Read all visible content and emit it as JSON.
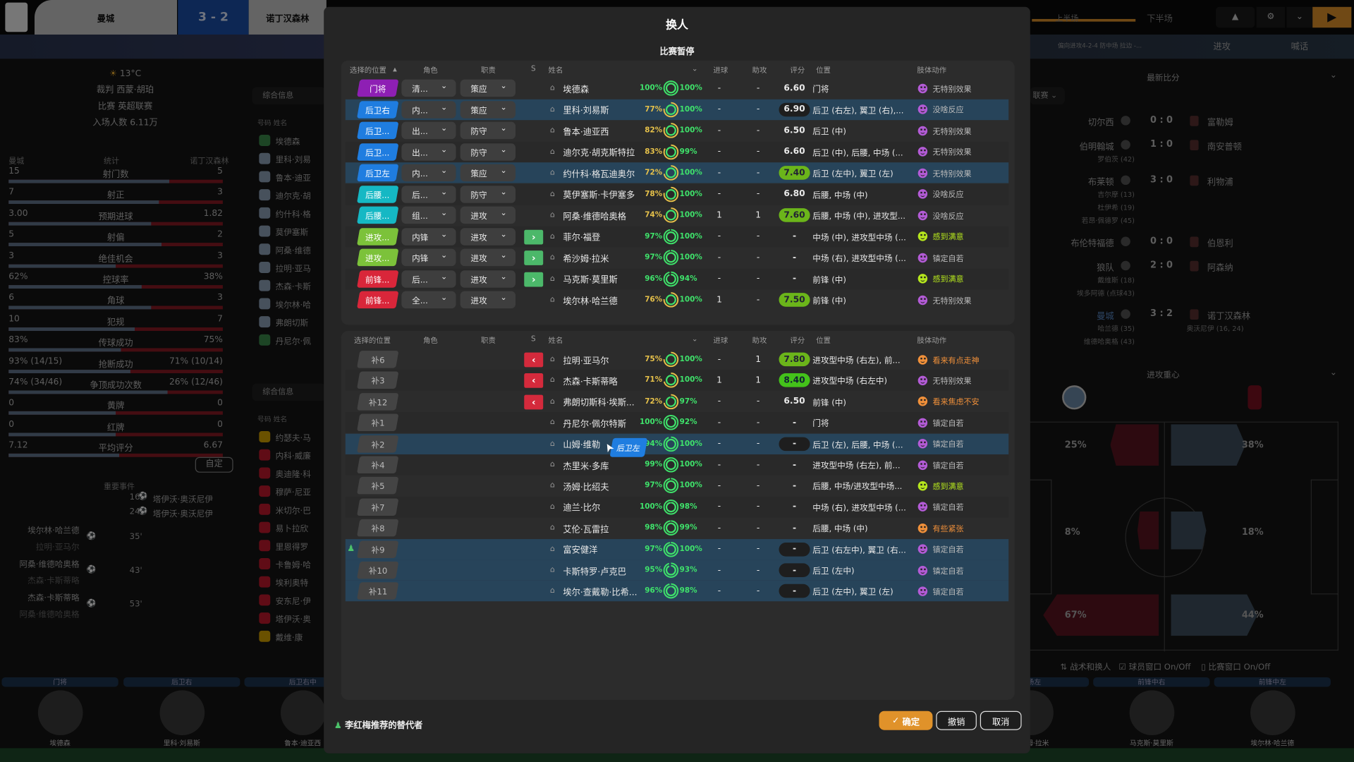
{
  "topbar": {
    "home": "曼城",
    "score": "3 - 2",
    "away": "诺丁汉森林",
    "league_logo": "Premier League",
    "half_first": "上半场",
    "half_second": "下半场",
    "tactic": "偏向进攻4-2-4 防中场 拉边 -...",
    "attack_label": "进攻",
    "shout_label": "喊话",
    "icons": [
      "car-icon",
      "gear-icon",
      "chevron-down-icon",
      "play-icon"
    ],
    "accent": "#e0922a"
  },
  "match_info": {
    "temp": "13°C",
    "referee": "裁判 西蒙·胡珀",
    "competition": "比赛 英超联赛",
    "attendance": "入场人数 6.11万"
  },
  "stats": {
    "home": "曼城",
    "title": "统计",
    "away": "诺丁汉森林",
    "custom_label": "自定",
    "rows": [
      {
        "label": "射门数",
        "home": "15",
        "away": "5",
        "share": 0.75
      },
      {
        "label": "射正",
        "home": "7",
        "away": "3",
        "share": 0.7
      },
      {
        "label": "预期进球",
        "home": "3.00",
        "away": "1.82",
        "share": 0.667
      },
      {
        "label": "射偏",
        "home": "5",
        "away": "2",
        "share": 0.715
      },
      {
        "label": "绝佳机会",
        "home": "3",
        "away": "3",
        "share": 0.5
      },
      {
        "label": "控球率",
        "home": "62%",
        "away": "38%",
        "share": 0.62
      },
      {
        "label": "角球",
        "home": "6",
        "away": "3",
        "share": 0.667
      },
      {
        "label": "犯规",
        "home": "10",
        "away": "7",
        "share": 0.59
      },
      {
        "label": "传球成功",
        "home": "83%",
        "away": "75%",
        "share": 0.525
      },
      {
        "label": "抢断成功",
        "home": "93% (14/15)",
        "away": "71% (10/14)",
        "share": 0.57
      },
      {
        "label": "争顶成功次数",
        "home": "74% (34/46)",
        "away": "26% (12/46)",
        "share": 0.74
      },
      {
        "label": "黄牌",
        "home": "0",
        "away": "0",
        "share": 0.5
      },
      {
        "label": "红牌",
        "home": "0",
        "away": "0",
        "share": 0.5
      },
      {
        "label": "平均评分",
        "home": "7.12",
        "away": "6.67",
        "share": 0.515
      }
    ]
  },
  "events": {
    "title": "重要事件",
    "items": [
      {
        "minute": "16'",
        "side": "away",
        "player": "塔伊沃·奥沃尼伊"
      },
      {
        "minute": "24'",
        "side": "away",
        "player": "塔伊沃·奥沃尼伊"
      },
      {
        "minute": "35'",
        "side": "home",
        "player": "埃尔林·哈兰德",
        "assist": "拉明·亚马尔"
      },
      {
        "minute": "43'",
        "side": "home",
        "player": "阿桑·维德哈奥格",
        "assist": "杰森·卡斯蒂略"
      },
      {
        "minute": "53'",
        "side": "home",
        "player": "杰森·卡斯蒂略",
        "assist": "阿桑·维德哈奥格"
      }
    ]
  },
  "lineups": {
    "filter_label": "综合信息",
    "col_number": "号码",
    "col_name": "姓名",
    "home": [
      "埃德森",
      "里科·刘易",
      "鲁本·迪亚",
      "迪尔克·胡",
      "约什科·格",
      "莫伊塞斯",
      "阿桑·维德",
      "拉明·亚马",
      "杰森·卡斯",
      "埃尔林·哈",
      "弗朗切斯",
      "丹尼尔·佩"
    ],
    "away": [
      "约瑟夫·马",
      "内科·威廉",
      "奥迪隆·科",
      "穆萨·尼亚",
      "米切尔·巴",
      "易卜拉欣",
      "里恩得罗",
      "卡鲁姆·哈",
      "埃利奥特",
      "安东尼·伊",
      "塔伊沃·奥",
      "戴维·康"
    ]
  },
  "modal": {
    "title": "换人",
    "subtitle": "比赛暂停",
    "headers": {
      "position": "选择的位置",
      "role": "角色",
      "duty": "职责",
      "s": "S",
      "name": "姓名",
      "goals": "进球",
      "assists": "助攻",
      "rating": "评分",
      "positions": "位置",
      "body_language": "肢体动作"
    },
    "starters": [
      {
        "pos": "门将",
        "posColor": "#8e1fb4",
        "role": "清...",
        "duty": "策应",
        "arrow": "",
        "name": "埃德森",
        "cond": "100%",
        "sharp": "100%",
        "goals": "-",
        "assists": "-",
        "rating": "6.60",
        "ratingStyle": "plain",
        "positions": "门将",
        "mood": "无特别效果",
        "moodColor": "#b35bd6",
        "hl": false
      },
      {
        "pos": "后卫右",
        "posColor": "#1f7de0",
        "role": "内...",
        "duty": "策应",
        "arrow": "",
        "name": "里科·刘易斯",
        "cond": "77%",
        "sharp": "100%",
        "goals": "-",
        "assists": "-",
        "rating": "6.90",
        "ratingStyle": "dark",
        "positions": "后卫 (右左), 翼卫 (右),...",
        "mood": "没啥反应",
        "moodColor": "#b35bd6",
        "hl": true
      },
      {
        "pos": "后卫...",
        "posColor": "#1f7de0",
        "role": "出...",
        "duty": "防守",
        "arrow": "",
        "name": "鲁本·迪亚西",
        "cond": "82%",
        "sharp": "100%",
        "goals": "-",
        "assists": "-",
        "rating": "6.50",
        "ratingStyle": "plain",
        "positions": "后卫 (中)",
        "mood": "无特别效果",
        "moodColor": "#b35bd6",
        "hl": false
      },
      {
        "pos": "后卫...",
        "posColor": "#1f7de0",
        "role": "出...",
        "duty": "防守",
        "arrow": "",
        "name": "迪尔克·胡克斯特拉",
        "cond": "83%",
        "sharp": "99%",
        "goals": "-",
        "assists": "-",
        "rating": "6.60",
        "ratingStyle": "plain",
        "positions": "后卫 (中), 后腰, 中场 (...",
        "mood": "无特别效果",
        "moodColor": "#b35bd6",
        "hl": false
      },
      {
        "pos": "后卫左",
        "posColor": "#1f7de0",
        "role": "内...",
        "duty": "策应",
        "arrow": "",
        "name": "约什科·格瓦迪奥尔",
        "cond": "72%",
        "sharp": "100%",
        "goals": "-",
        "assists": "-",
        "rating": "7.40",
        "ratingStyle": "green",
        "positions": "后卫 (左中), 翼卫 (左)",
        "mood": "无特别效果",
        "moodColor": "#b35bd6",
        "hl": true
      },
      {
        "pos": "后腰...",
        "posColor": "#15b8c4",
        "role": "后...",
        "duty": "防守",
        "arrow": "",
        "name": "莫伊塞斯·卡伊塞多",
        "cond": "78%",
        "sharp": "100%",
        "goals": "-",
        "assists": "-",
        "rating": "6.80",
        "ratingStyle": "plain",
        "positions": "后腰, 中场 (中)",
        "mood": "没啥反应",
        "moodColor": "#b35bd6",
        "hl": false
      },
      {
        "pos": "后腰...",
        "posColor": "#15b8c4",
        "role": "组...",
        "duty": "进攻",
        "arrow": "",
        "name": "阿桑·维德哈奥格",
        "cond": "74%",
        "sharp": "100%",
        "goals": "1",
        "assists": "1",
        "rating": "7.60",
        "ratingStyle": "green",
        "positions": "后腰, 中场 (中), 进攻型...",
        "mood": "没啥反应",
        "moodColor": "#b35bd6",
        "hl": false
      },
      {
        "pos": "进攻...",
        "posColor": "#7cc23a",
        "role": "内锋",
        "duty": "进攻",
        "arrow": "out",
        "name": "菲尔·福登",
        "cond": "97%",
        "sharp": "100%",
        "goals": "-",
        "assists": "-",
        "rating": "-",
        "ratingStyle": "plain",
        "positions": "中场 (中), 进攻型中场 (...",
        "mood": "感到满意",
        "moodColor": "#b5e61d",
        "hl": false
      },
      {
        "pos": "进攻...",
        "posColor": "#7cc23a",
        "role": "内锋",
        "duty": "进攻",
        "arrow": "out",
        "name": "希沙姆·拉米",
        "cond": "97%",
        "sharp": "100%",
        "goals": "-",
        "assists": "-",
        "rating": "-",
        "ratingStyle": "plain",
        "positions": "中场 (右), 进攻型中场 (...",
        "mood": "镇定自若",
        "moodColor": "#b35bd6",
        "hl": false
      },
      {
        "pos": "前锋...",
        "posColor": "#d9263a",
        "role": "后...",
        "duty": "进攻",
        "arrow": "out",
        "name": "马克斯·莫里斯",
        "cond": "96%",
        "sharp": "94%",
        "goals": "-",
        "assists": "-",
        "rating": "-",
        "ratingStyle": "plain",
        "positions": "前锋 (中)",
        "mood": "感到满意",
        "moodColor": "#b5e61d",
        "hl": false
      },
      {
        "pos": "前锋...",
        "posColor": "#d9263a",
        "role": "全...",
        "duty": "进攻",
        "arrow": "",
        "name": "埃尔林·哈兰德",
        "cond": "76%",
        "sharp": "100%",
        "goals": "1",
        "assists": "-",
        "rating": "7.50",
        "ratingStyle": "green",
        "positions": "前锋 (中)",
        "mood": "无特别效果",
        "moodColor": "#b35bd6",
        "hl": false
      }
    ],
    "subs": [
      {
        "pos": "补6",
        "arrow": "in",
        "name": "拉明·亚马尔",
        "cond": "75%",
        "sharp": "100%",
        "goals": "-",
        "assists": "1",
        "rating": "7.80",
        "ratingStyle": "green",
        "positions": "进攻型中场 (右左), 前...",
        "mood": "看来有点走神",
        "moodColor": "#f0903a",
        "hl": false
      },
      {
        "pos": "补3",
        "arrow": "in",
        "name": "杰森·卡斯蒂略",
        "cond": "71%",
        "sharp": "100%",
        "goals": "1",
        "assists": "1",
        "rating": "8.40",
        "ratingStyle": "bright",
        "positions": "进攻型中场 (右左中)",
        "mood": "无特别效果",
        "moodColor": "#b35bd6",
        "hl": false
      },
      {
        "pos": "补12",
        "arrow": "in",
        "name": "弗朗切斯科·埃斯...",
        "cond": "72%",
        "sharp": "97%",
        "goals": "-",
        "assists": "-",
        "rating": "6.50",
        "ratingStyle": "plain",
        "positions": "前锋 (中)",
        "mood": "看来焦虑不安",
        "moodColor": "#f0903a",
        "hl": false
      },
      {
        "pos": "补1",
        "arrow": "",
        "name": "丹尼尔·佩尔特斯",
        "cond": "100%",
        "sharp": "92%",
        "goals": "-",
        "assists": "-",
        "rating": "-",
        "ratingStyle": "plain",
        "positions": "门将",
        "mood": "镇定自若",
        "moodColor": "#b35bd6",
        "hl": false
      },
      {
        "pos": "补2",
        "arrow": "",
        "name": "山姆·维勒",
        "cond": "94%",
        "sharp": "100%",
        "goals": "-",
        "assists": "-",
        "rating": "-",
        "ratingStyle": "dark",
        "positions": "后卫 (左), 后腰, 中场 (...",
        "mood": "镇定自若",
        "moodColor": "#b35bd6",
        "hl": true,
        "drag": "后卫左"
      },
      {
        "pos": "补4",
        "arrow": "",
        "name": "杰里米·多库",
        "cond": "99%",
        "sharp": "100%",
        "goals": "-",
        "assists": "-",
        "rating": "-",
        "ratingStyle": "plain",
        "positions": "进攻型中场 (右左), 前...",
        "mood": "镇定自若",
        "moodColor": "#b35bd6",
        "hl": false
      },
      {
        "pos": "补5",
        "arrow": "",
        "name": "汤姆·比绍夫",
        "cond": "97%",
        "sharp": "100%",
        "goals": "-",
        "assists": "-",
        "rating": "-",
        "ratingStyle": "plain",
        "positions": "后腰, 中场/进攻型中场...",
        "mood": "感到满意",
        "moodColor": "#b5e61d",
        "hl": false
      },
      {
        "pos": "补7",
        "arrow": "",
        "name": "迪兰·比尔",
        "cond": "100%",
        "sharp": "98%",
        "goals": "-",
        "assists": "-",
        "rating": "-",
        "ratingStyle": "plain",
        "positions": "中场 (右), 进攻型中场 (...",
        "mood": "镇定自若",
        "moodColor": "#b35bd6",
        "hl": false
      },
      {
        "pos": "补8",
        "arrow": "",
        "name": "艾伦·瓦雷拉",
        "cond": "98%",
        "sharp": "99%",
        "goals": "-",
        "assists": "-",
        "rating": "-",
        "ratingStyle": "plain",
        "positions": "后腰, 中场 (中)",
        "mood": "有些紧张",
        "moodColor": "#f0903a",
        "hl": false
      },
      {
        "pos": "补9",
        "arrow": "",
        "name": "富安健洋",
        "cond": "97%",
        "sharp": "100%",
        "goals": "-",
        "assists": "-",
        "rating": "-",
        "ratingStyle": "dark",
        "positions": "后卫 (右左中), 翼卫 (右...",
        "mood": "镇定自若",
        "moodColor": "#b35bd6",
        "hl": true,
        "recommended": true
      },
      {
        "pos": "补10",
        "arrow": "",
        "name": "卡斯特罗·卢克巴",
        "cond": "95%",
        "sharp": "93%",
        "goals": "-",
        "assists": "-",
        "rating": "-",
        "ratingStyle": "dark",
        "positions": "后卫 (左中)",
        "mood": "镇定自若",
        "moodColor": "#b35bd6",
        "hl": true
      },
      {
        "pos": "补11",
        "arrow": "",
        "name": "埃尔·查戴勒·比希...",
        "cond": "96%",
        "sharp": "98%",
        "goals": "-",
        "assists": "-",
        "rating": "-",
        "ratingStyle": "dark",
        "positions": "后卫 (左中), 翼卫 (左)",
        "mood": "镇定自若",
        "moodColor": "#b35bd6",
        "hl": true
      }
    ],
    "footer": {
      "recommend": "李红梅推荐的替代者",
      "confirm": "确定",
      "undo": "撤销",
      "cancel": "取消"
    }
  },
  "latest_scores": {
    "title": "最新比分",
    "filter": "联赛",
    "matches": [
      {
        "home": "切尔西",
        "score": "0 : 0",
        "away": "富勒姆",
        "home_scorers": [],
        "away_scorers": []
      },
      {
        "home": "伯明翰城",
        "score": "1 : 0",
        "away": "南安普顿",
        "home_scorers": [
          "罗伯茨 (42)"
        ],
        "away_scorers": []
      },
      {
        "home": "布莱顿",
        "score": "3 : 0",
        "away": "利物浦",
        "home_scorers": [
          "吉尔摩 (13)",
          "杜伊希 (19)",
          "若昂·佩德罗 (45)"
        ],
        "away_scorers": []
      },
      {
        "home": "布伦特福德",
        "score": "0 : 0",
        "away": "伯恩利",
        "home_scorers": [],
        "away_scorers": []
      },
      {
        "home": "狼队",
        "score": "2 : 0",
        "away": "阿森纳",
        "home_scorers": [
          "戴维斯 (18)",
          "埃多阿德 (点球43)"
        ],
        "away_scorers": []
      },
      {
        "home": "曼城",
        "score": "3 : 2",
        "away": "诺丁汉森林",
        "home_scorers": [
          "哈兰德 (35)",
          "维德哈奥格 (43)"
        ],
        "away_scorers": [
          "奥沃尼伊 (16, 24)"
        ]
      }
    ]
  },
  "attack_focus": {
    "title": "进攻重心",
    "home": {
      "left": "25%",
      "center": "8%",
      "right": "67%"
    },
    "away": {
      "left": "38%",
      "center": "18%",
      "right": "44%"
    },
    "home_color": "#5a1520",
    "away_color": "#3f4f5e"
  },
  "bottom": {
    "tactics_label": "战术和换人",
    "player_window": "球员窗口 On/Off",
    "match_window": "比赛窗口 On/Off",
    "cards": [
      {
        "pos": "门将",
        "name": "埃德森"
      },
      {
        "pos": "后卫右",
        "name": "里科·刘易斯"
      },
      {
        "pos": "后卫右中",
        "name": "鲁本·迪亚西"
      },
      {
        "pos": "中场左",
        "name": "希沙姆·拉米"
      },
      {
        "pos": "前锋中右",
        "name": "马克斯·莫里斯"
      },
      {
        "pos": "前锋中左",
        "name": "埃尔林·哈兰德"
      }
    ]
  }
}
